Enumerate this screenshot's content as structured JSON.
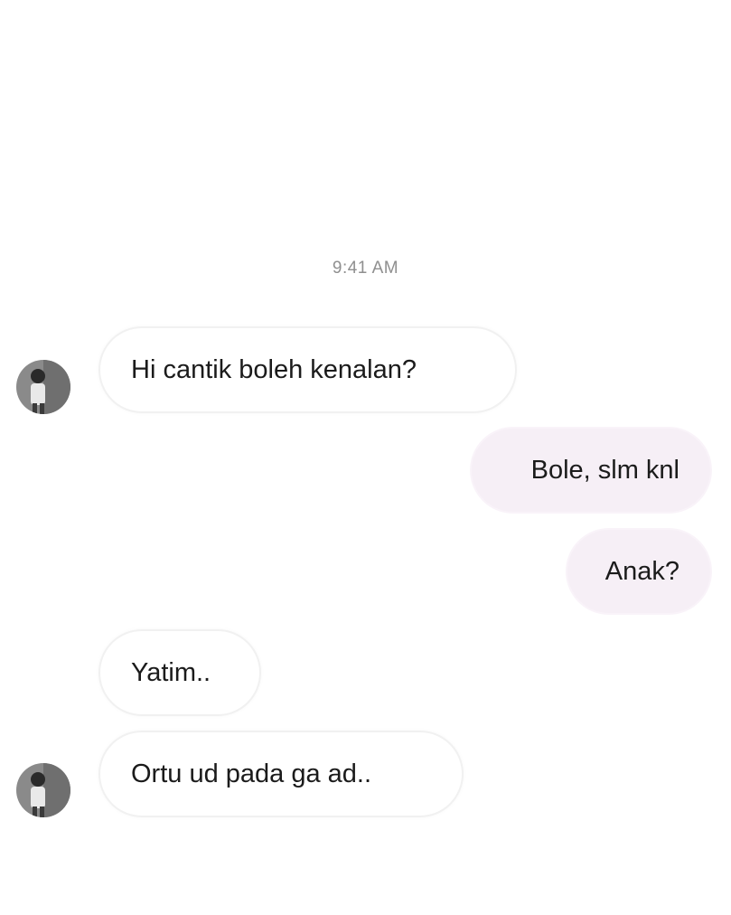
{
  "thread": {
    "timestamp": "9:41 AM",
    "messages": [
      {
        "sender": "them",
        "text": "Hi cantik boleh kenalan?"
      },
      {
        "sender": "me",
        "text": "Bole, slm knl"
      },
      {
        "sender": "me",
        "text": "Anak?"
      },
      {
        "sender": "them",
        "text": "Yatim.."
      },
      {
        "sender": "them",
        "text": "Ortu ud pada ga ad.."
      }
    ]
  },
  "colors": {
    "outgoing_bubble": "#f6eff6",
    "incoming_bubble": "#ffffff",
    "timestamp_text": "#8f8f8f"
  },
  "icons": {
    "contact_avatar": "profile-photo-icon"
  }
}
